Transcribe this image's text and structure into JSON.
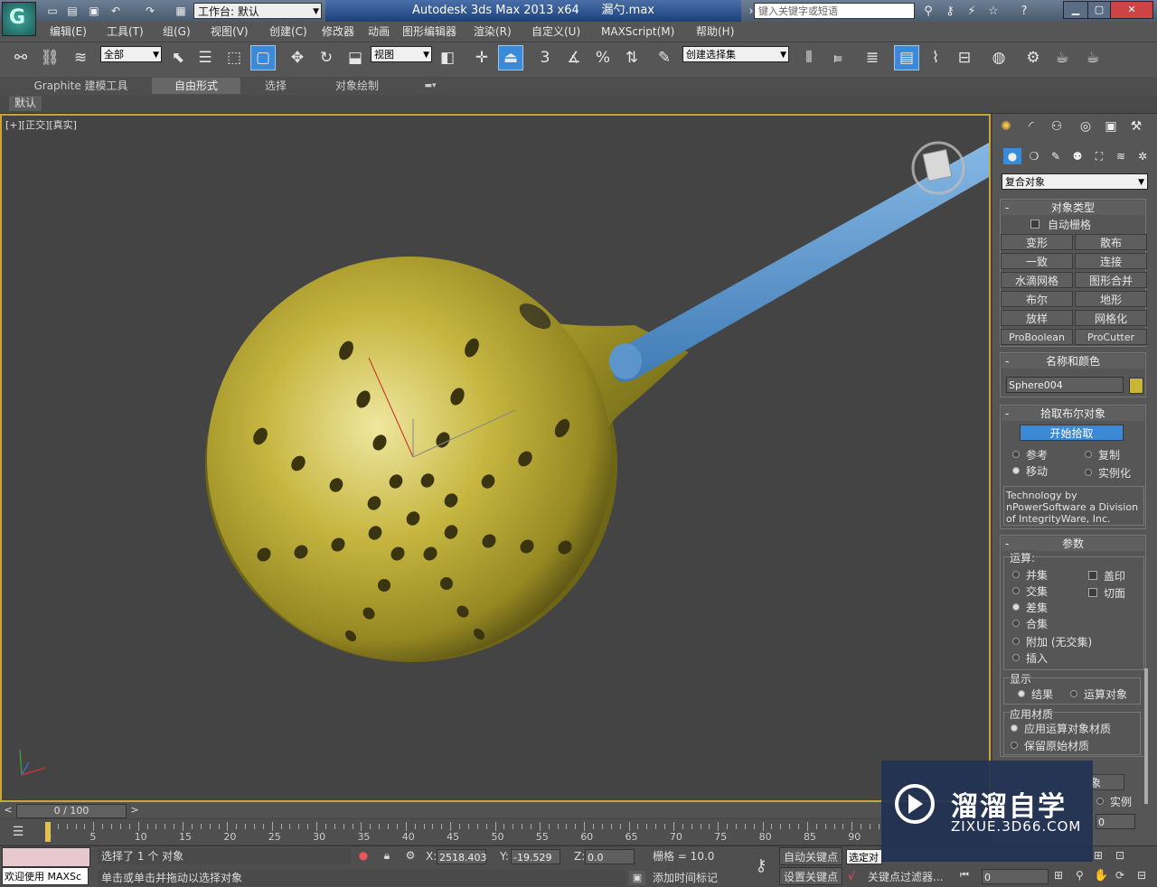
{
  "titlebar": {
    "workspace_label": "工作台: 默认",
    "app_title": "Autodesk 3ds Max  2013 x64",
    "file_name": "漏勺.max",
    "search_placeholder": "键入关键字或短语",
    "app_logo": "G"
  },
  "menus": [
    "编辑(E)",
    "工具(T)",
    "组(G)",
    "视图(V)",
    "创建(C)",
    "修改器",
    "动画",
    "图形编辑器",
    "渲染(R)",
    "自定义(U)",
    "MAXScript(M)",
    "帮助(H)"
  ],
  "toolbar": {
    "selection_filter": "全部",
    "ref_coord": "视图",
    "named_selection": "创建选择集",
    "snap_3d": "3",
    "percent_snap": "%"
  },
  "ribbon": {
    "tabs": [
      "Graphite 建模工具",
      "自由形式",
      "选择",
      "对象绘制"
    ],
    "active_tab": "自由形式",
    "sub_button": "默认"
  },
  "viewport": {
    "label": "[+][正交][真实]",
    "selected_object": "Sphere004",
    "bowl_color": "#b7a82c",
    "handle_color": "#5b95cb",
    "background": "#444444"
  },
  "cmdpanel": {
    "category": "复合对象",
    "object_type": {
      "title": "对象类型",
      "autogrid": "自动栅格",
      "buttons": [
        "变形",
        "散布",
        "一致",
        "连接",
        "水滴网格",
        "图形合并",
        "布尔",
        "地形",
        "放样",
        "网格化",
        "ProBoolean",
        "ProCutter"
      ]
    },
    "name_color": {
      "title": "名称和颜色",
      "name_value": "Sphere004",
      "swatch": "#c9b53a"
    },
    "pick_boolean": {
      "title": "拾取布尔对象",
      "start_pick": "开始拾取",
      "ref": "参考",
      "copy": "复制",
      "move": "移动",
      "instance": "实例化",
      "credit": "Technology by nPowerSoftware a Division of IntegrityWare, Inc."
    },
    "params": {
      "title": "参数",
      "operation": "运算:",
      "ops": [
        "并集",
        "交集",
        "差集",
        "合集",
        "附加 (无交集)",
        "插入"
      ],
      "selected_op": "差集",
      "imprint": "盖印",
      "cookie": "切面",
      "display": "显示",
      "result": "结果",
      "operands": "运算对象",
      "apply_material": "应用材质",
      "apply_op_mat": "应用运算对象材质",
      "keep_orig_mat": "保留原始材质",
      "partial_btn": "象",
      "partial_instance": "实例",
      "spinner_value": "0"
    }
  },
  "timeline": {
    "slider_text": "0 / 100",
    "ticks": [
      "0",
      "5",
      "10",
      "15",
      "20",
      "25",
      "30",
      "35",
      "40",
      "45",
      "50",
      "55",
      "60",
      "65",
      "70",
      "75",
      "80",
      "85",
      "90"
    ]
  },
  "status": {
    "welcome": "欢迎使用 MAXSc",
    "selected_info": "选择了 1 个 对象",
    "prompt": "单击或单击并拖动以选择对象",
    "x_value": "2518.403",
    "y_value": "-19.529",
    "z_value": "0.0",
    "grid": "栅格 = 10.0",
    "add_time_tag": "添加时间标记",
    "auto_key": "自动关键点",
    "set_key": "设置关键点",
    "selected_btn": "选定对",
    "key_filters": "关键点过滤器...",
    "frame": "0"
  },
  "watermark": {
    "title": "溜溜自学",
    "url": "ZIXUE.3D66.COM"
  }
}
